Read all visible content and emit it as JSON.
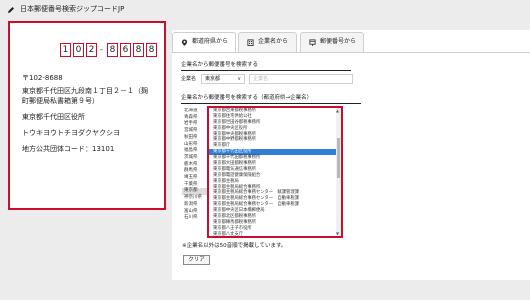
{
  "header": {
    "title": "日本郵便番号検索ジップコードJP"
  },
  "card": {
    "postal_digits": [
      "1",
      "0",
      "2",
      "8",
      "6",
      "8",
      "8"
    ],
    "postal_dash": "-",
    "postal_text": "〒102-8688",
    "address_line1": "東京都千代田区九段南１丁目２－１（麹",
    "address_line2": "町郵便局私書箱第９号）",
    "office_name": "東京都千代田区役所",
    "office_kana": "トウキヨウトチヨダクヤクシヨ",
    "local_gov_code": "地方公共団体コード：13101"
  },
  "tabs": [
    {
      "label": "都道府県から",
      "icon": "map-pin-icon",
      "active": true
    },
    {
      "label": "企業名から",
      "icon": "building-icon",
      "active": false
    },
    {
      "label": "郵便番号から",
      "icon": "mailbox-icon",
      "active": false
    }
  ],
  "search_by_name": {
    "heading": "企業名から郵便番号を検索する",
    "field_label": "企業名",
    "pref_value": "東京都",
    "name_placeholder": "企業名"
  },
  "search_by_pref": {
    "heading": "企業名から郵便番号を検索する（都道府県→企業名）",
    "prefectures": [
      "北海道",
      "青森県",
      "岩手県",
      "宮城県",
      "秋田県",
      "山形県",
      "福島県",
      "茨城県",
      "栃木県",
      "群馬県",
      "埼玉県",
      "千葉県",
      "東京都",
      "神奈川県",
      "新潟県",
      "富山県",
      "石川県"
    ],
    "selected_pref": "東京都",
    "offices": [
      "東京都台東都税事務所",
      "東京都住宅供給公社",
      "東京都世田谷都税事務所",
      "東京都中央区役所",
      "東京都中央都税事務所",
      "東京都中野都税事務所",
      "東京都庁",
      "東京都千代田区役所",
      "東京都千代田都税事務所",
      "東京都大田都税事務所",
      "東京都電気通信事務所",
      "東京都電話健康保険組合",
      "東京都主税局",
      "東京都主税局総合事務所",
      "東京都主税局総合事務センター　賦課管理課",
      "東京都主税局総合事務センター　自動車税課",
      "東京都主税局総合事務センター　自動車税課",
      "東京都中央区日本橋郵便局",
      "東京都北区都税事務所",
      "東京都練馬都税事務所",
      "東京都八王子市役所",
      "東京都八丈支庁",
      "東京都文京都税事務所"
    ],
    "highlighted_office": "東京都千代田区役所"
  },
  "note": "※企業名以外は50音順で掲載しています。",
  "clear_button": "クリア",
  "colors": {
    "accent": "#c8102e",
    "selection": "#2f7ed8"
  }
}
